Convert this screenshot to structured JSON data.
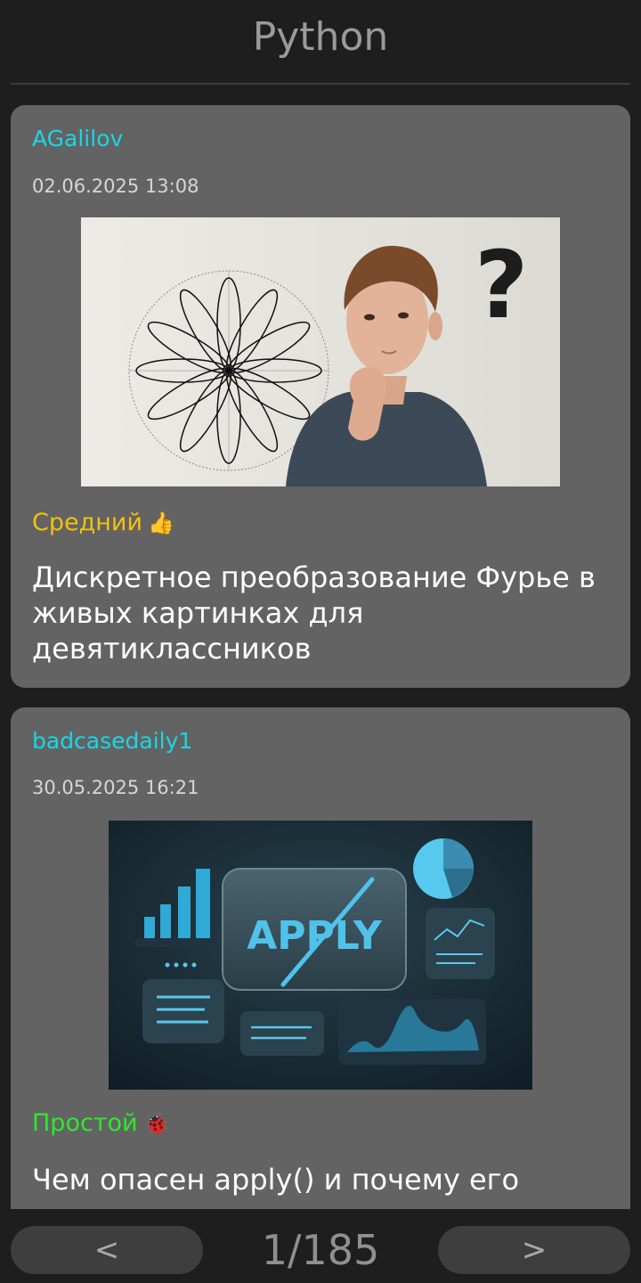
{
  "header": {
    "title": "Python"
  },
  "posts": [
    {
      "author": "AGalilov",
      "date": "02.06.2025 13:08",
      "level": "Средний",
      "level_icon": "👍",
      "level_color": "#f2c10f",
      "title": "Дискретное преобразование Фурье в живых картинках для девятиклассников",
      "image_icon": "fourier-rose-curve-illustration"
    },
    {
      "author": "badcasedaily1",
      "date": "30.05.2025 16:21",
      "level": "Простой",
      "level_icon": "🐞",
      "level_color": "#2ee82e",
      "title": "Чем опасен apply() и почему его стоит",
      "image_icon": "apply-dashboard-illustration",
      "image_text": "APPLY"
    }
  ],
  "pagination": {
    "prev": "<",
    "next": ">",
    "counter": "1/185"
  }
}
